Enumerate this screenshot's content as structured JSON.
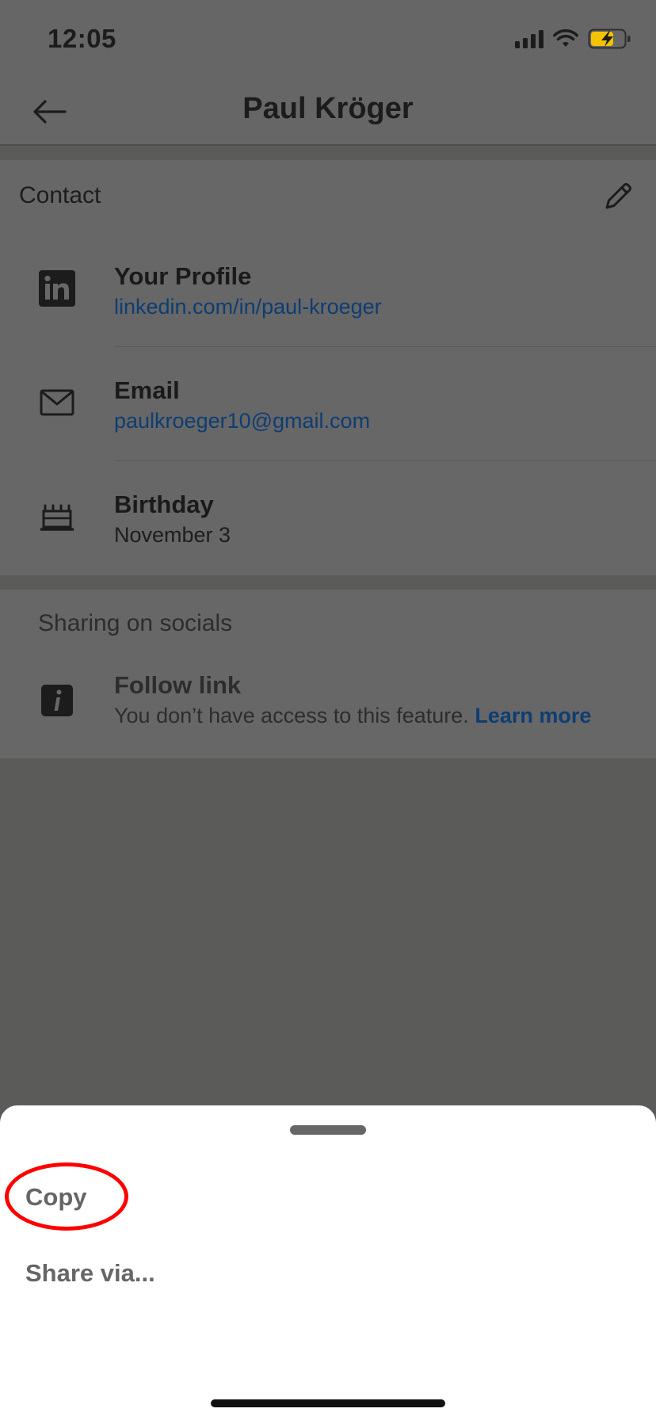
{
  "status_bar": {
    "time": "12:05",
    "icons": [
      "signal-icon",
      "wifi-icon",
      "battery-charging-icon"
    ],
    "battery_color": "#f5c200"
  },
  "header": {
    "title": "Paul Kröger",
    "back_icon": "arrow-left-icon"
  },
  "contact": {
    "section_title": "Contact",
    "edit_icon": "pencil-icon",
    "rows": [
      {
        "icon": "linkedin-icon",
        "title": "Your Profile",
        "value": "linkedin.com/in/paul-kroeger"
      },
      {
        "icon": "mail-icon",
        "title": "Email",
        "value": "paulkroeger10@gmail.com"
      },
      {
        "icon": "cake-icon",
        "title": "Birthday",
        "value": "November 3"
      }
    ]
  },
  "socials": {
    "section_title": "Sharing on socials",
    "row": {
      "icon": "info-icon",
      "title": "Follow link",
      "text": "You don’t have access to this feature.",
      "link": "Learn more"
    }
  },
  "sheet": {
    "items": [
      "Copy",
      "Share via..."
    ]
  },
  "colors": {
    "link": "#0e3d72",
    "highlight": "#ff0000",
    "overlay": "#5b5b5a"
  }
}
